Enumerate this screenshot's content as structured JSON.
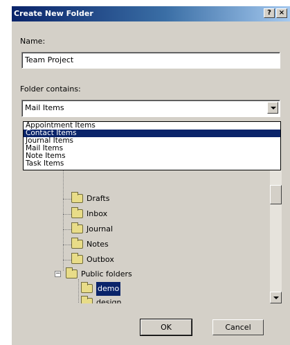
{
  "dialog": {
    "title": "Create New Folder",
    "help_button": "?",
    "close_button": "×"
  },
  "name_section": {
    "label": "Name:",
    "value": "Team Project"
  },
  "contains_section": {
    "label": "Folder contains:",
    "selected": "Mail Items",
    "options": [
      {
        "label": "Appointment Items",
        "selected": false
      },
      {
        "label": "Contact Items",
        "selected": true
      },
      {
        "label": "Journal Items",
        "selected": false
      },
      {
        "label": "Mail Items",
        "selected": false
      },
      {
        "label": "Note Items",
        "selected": false
      },
      {
        "label": "Task Items",
        "selected": false
      }
    ]
  },
  "tree": {
    "items": [
      {
        "label": "Drafts",
        "icon": "drafts-folder-icon"
      },
      {
        "label": "Inbox",
        "icon": "inbox-folder-icon"
      },
      {
        "label": "Journal",
        "icon": "journal-folder-icon"
      },
      {
        "label": "Notes",
        "icon": "notes-folder-icon"
      },
      {
        "label": "Outbox",
        "icon": "outbox-folder-icon"
      },
      {
        "label": "Public folders",
        "icon": "public-folders-icon"
      },
      {
        "label": "demo",
        "icon": "folder-icon"
      },
      {
        "label": "design",
        "icon": "folder-icon"
      }
    ]
  },
  "buttons": {
    "ok": "OK",
    "cancel": "Cancel"
  }
}
